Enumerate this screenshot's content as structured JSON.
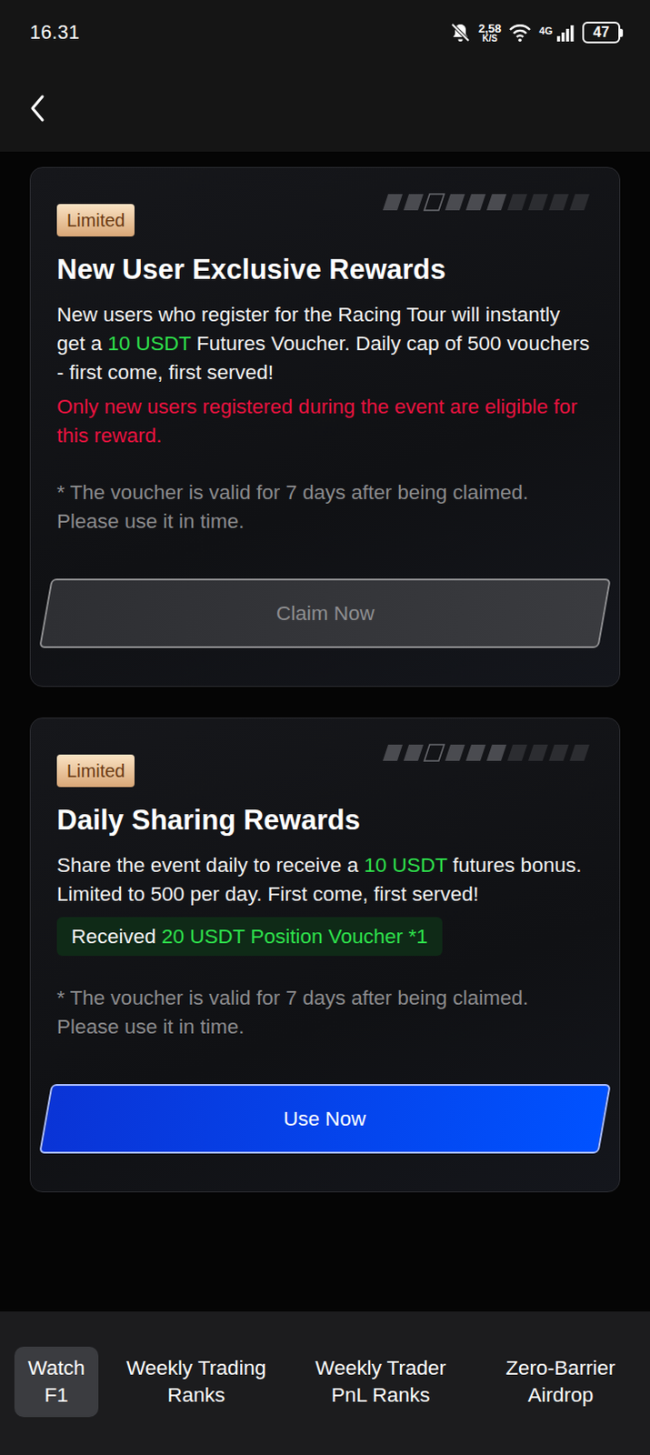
{
  "status_bar": {
    "time": "16.31",
    "speed": "2,58",
    "speed_unit": "K/S",
    "network": "4G",
    "battery": "47"
  },
  "cards": [
    {
      "badge": "Limited",
      "title": "New User Exclusive Rewards",
      "description": [
        {
          "text": "New users who register for the Racing Tour will instantly get a ",
          "highlight": false
        },
        {
          "text": "10 USDT",
          "highlight": true
        },
        {
          "text": " Futures Voucher. Daily cap of 500 vouchers - first come, first served!",
          "highlight": false
        }
      ],
      "warning": "Only new users registered during the event are eligible for this reward.",
      "note": "* The voucher is valid for 7 days after being claimed. Please use it in time.",
      "button": {
        "label": "Claim Now",
        "disabled": true
      }
    },
    {
      "badge": "Limited",
      "title": "Daily Sharing Rewards",
      "description": [
        {
          "text": "Share the event daily to receive a ",
          "highlight": false
        },
        {
          "text": "10 USDT",
          "highlight": true
        },
        {
          "text": " futures bonus. Limited to 500 per day. First come, first served!",
          "highlight": false
        }
      ],
      "received": {
        "prefix": "Received",
        "value": "20 USDT Position Voucher *1"
      },
      "note": "* The voucher is valid for 7 days after being claimed. Please use it in time.",
      "button": {
        "label": "Use Now",
        "disabled": false
      }
    }
  ],
  "tabs": [
    {
      "label": "Watch F1",
      "selected": true
    },
    {
      "label": "Weekly Trading Ranks",
      "selected": false
    },
    {
      "label": "Weekly Trader PnL Ranks",
      "selected": false
    },
    {
      "label": "Zero-Barrier Airdrop",
      "selected": false
    }
  ]
}
